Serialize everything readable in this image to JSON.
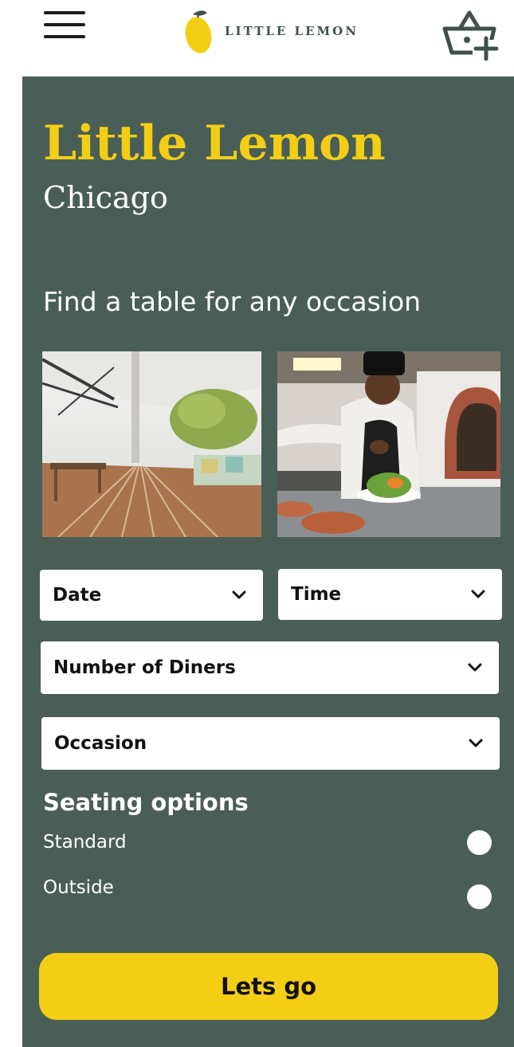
{
  "header": {
    "logo_text": "LITTLE LEMON",
    "menu_icon": "hamburger-menu-icon",
    "cart_icon": "basket-add-icon"
  },
  "hero": {
    "title": "Little Lemon",
    "city": "Chicago",
    "tagline": "Find a table for any occasion"
  },
  "form": {
    "date_label": "Date",
    "time_label": "Time",
    "diners_label": "Number of Diners",
    "occasion_label": "Occasion",
    "seating": {
      "heading": "Seating options",
      "options": [
        "Standard",
        "Outside"
      ]
    },
    "submit_label": "Lets go"
  },
  "colors": {
    "primary_green": "#495e57",
    "primary_yellow": "#f4ce14",
    "text_dark": "#111111",
    "white": "#ffffff"
  }
}
